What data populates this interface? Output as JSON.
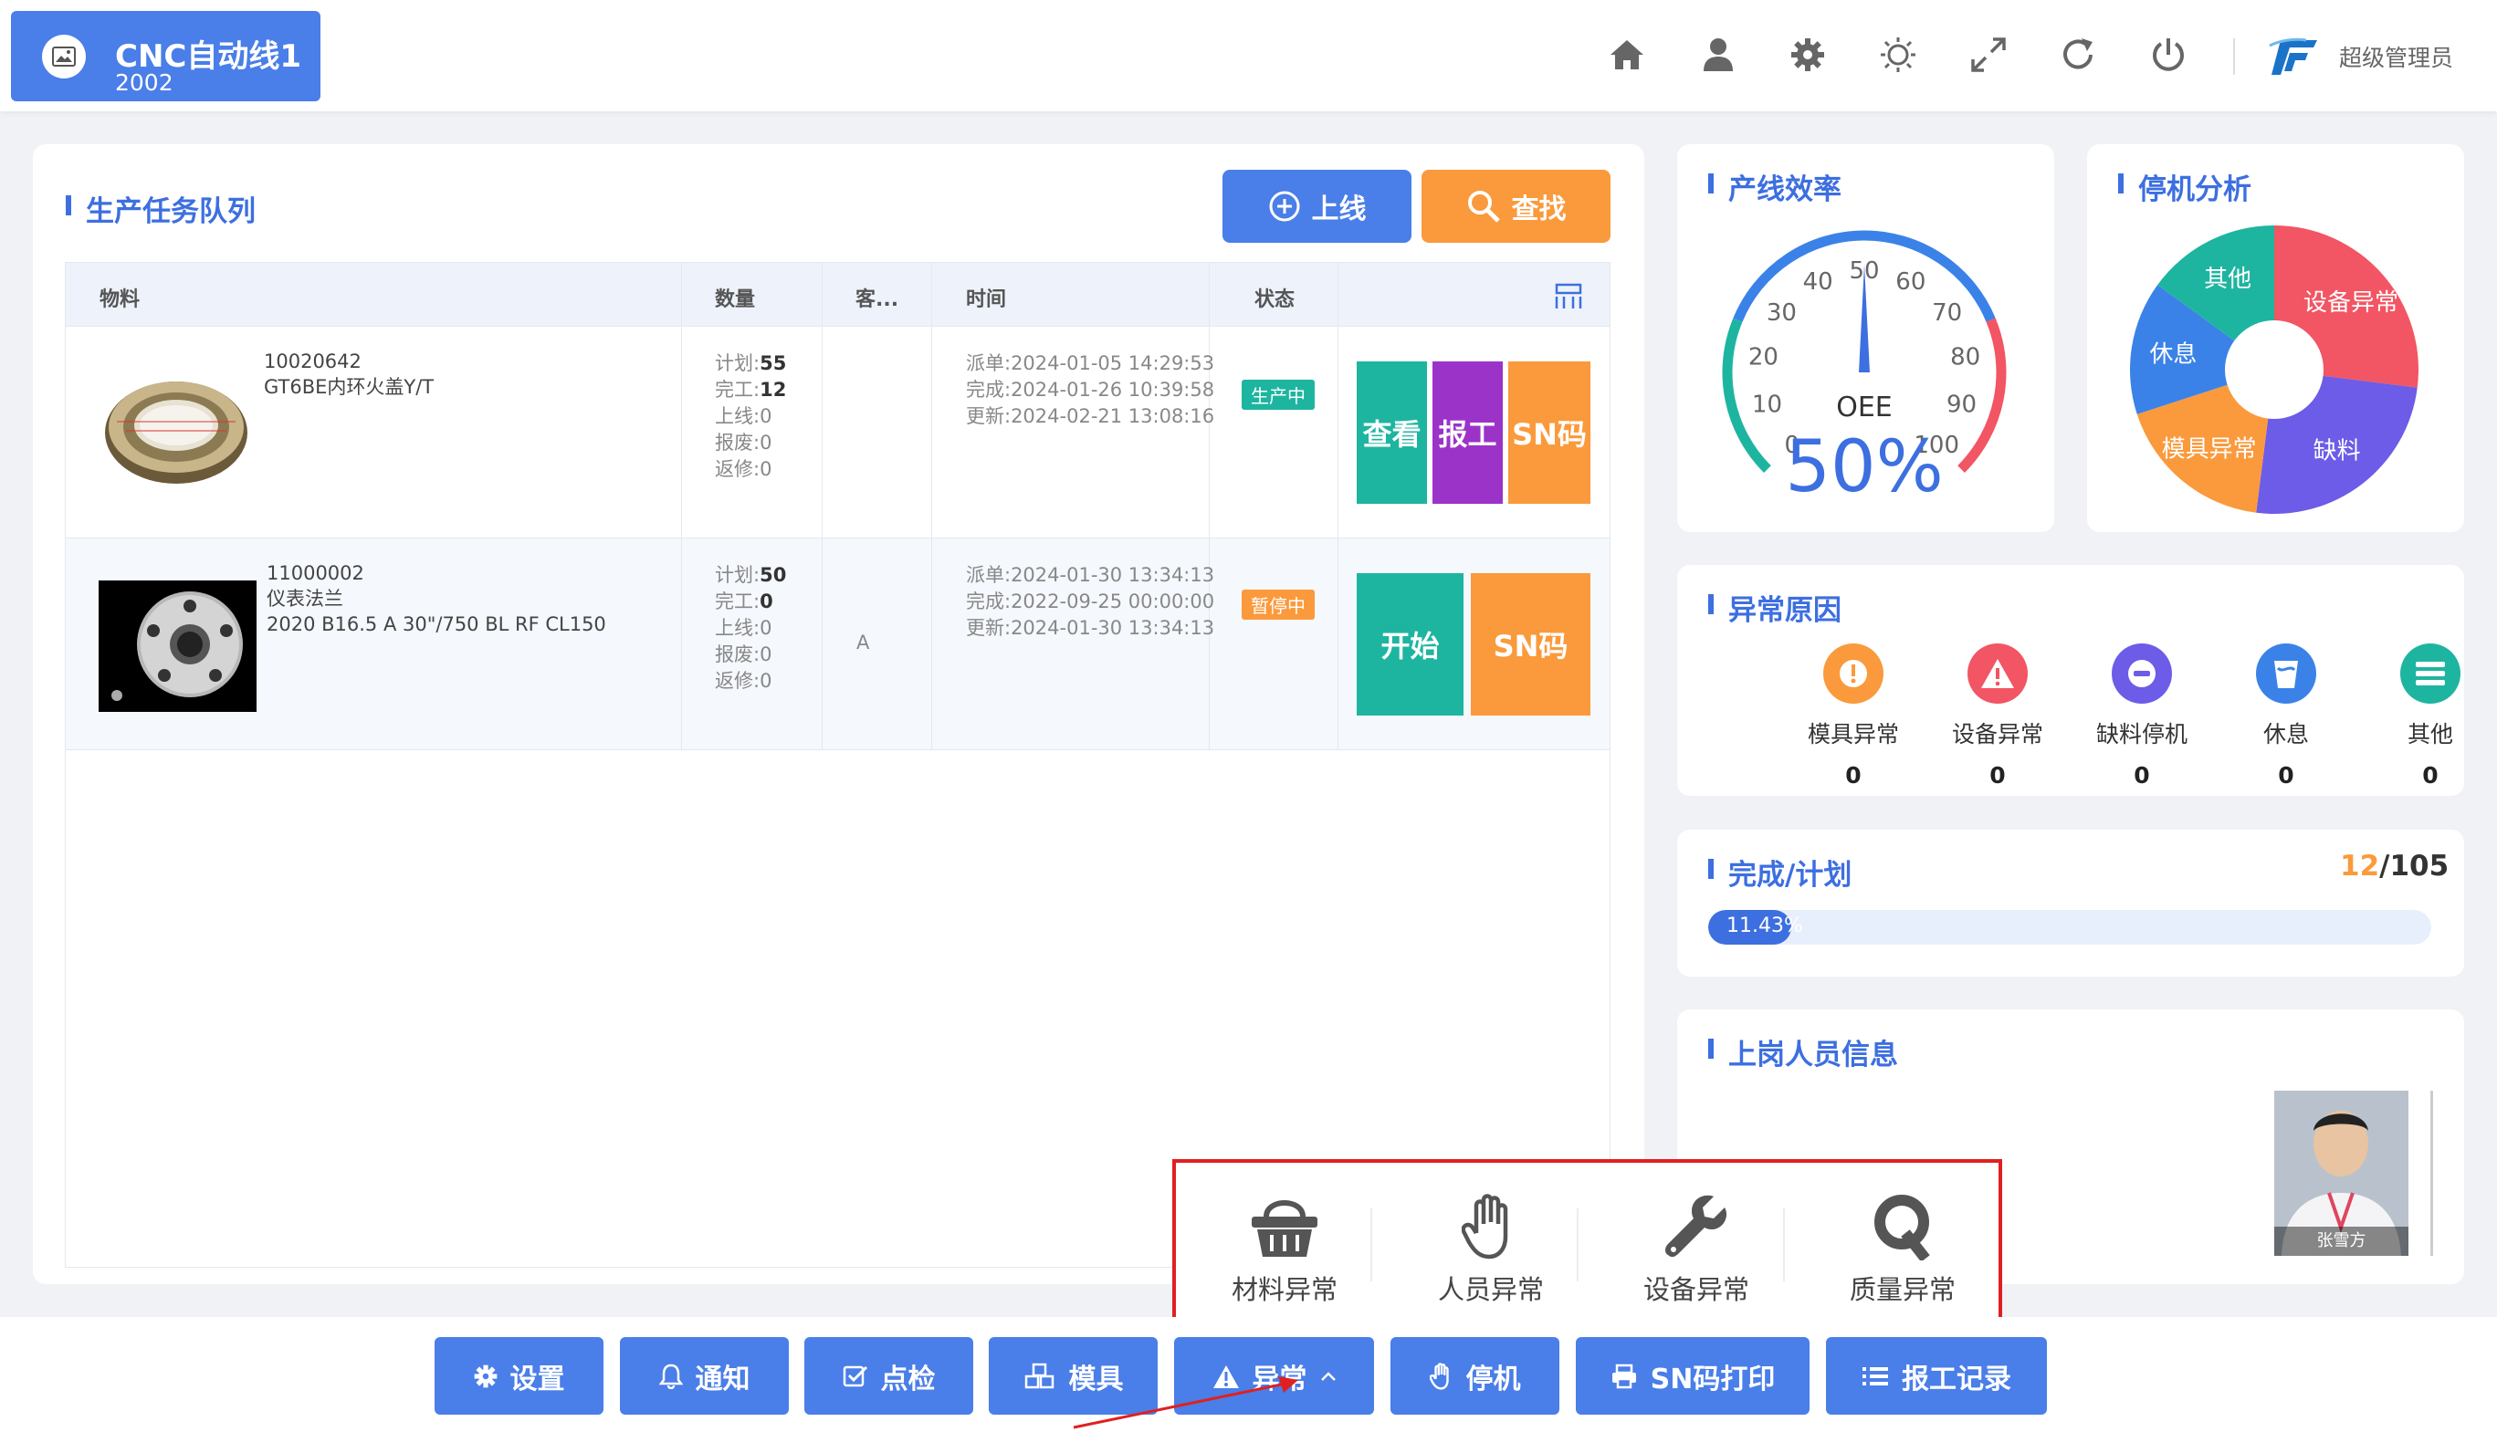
{
  "header": {
    "line_name": "CNC自动线1",
    "line_code": "2002",
    "user": "超级管理员",
    "icons": [
      "home-icon",
      "user-icon",
      "gear-icon",
      "brightness-icon",
      "fullscreen-icon",
      "refresh-icon",
      "power-icon"
    ]
  },
  "queue": {
    "title": "生产任务队列",
    "online_label": "上线",
    "search_label": "查找",
    "columns": [
      "物料",
      "数量",
      "客...",
      "时间",
      "状态"
    ],
    "rows": [
      {
        "code": "10020642",
        "name": "GT6BE内环火盖Y/T",
        "name2": "",
        "qty": [
          {
            "k": "计划:",
            "v": "55"
          },
          {
            "k": "完工:",
            "v": "12"
          },
          {
            "k": "上线:",
            "v": "0"
          },
          {
            "k": "报废:",
            "v": "0"
          },
          {
            "k": "返修:",
            "v": "0"
          }
        ],
        "customer": "",
        "times": [
          "派单:2024-01-05 14:29:53",
          "完成:2024-01-26 10:39:58",
          "更新:2024-02-21 13:08:16"
        ],
        "status": "生产中",
        "actions": [
          "查看",
          "报工",
          "SN码"
        ]
      },
      {
        "code": "11000002",
        "name": "仪表法兰",
        "name2": "2020 B16.5 A 30\"/750 BL RF CL150",
        "qty": [
          {
            "k": "计划:",
            "v": "50"
          },
          {
            "k": "完工:",
            "v": "0"
          },
          {
            "k": "上线:",
            "v": "0"
          },
          {
            "k": "报废:",
            "v": "0"
          },
          {
            "k": "返修:",
            "v": "0"
          }
        ],
        "customer": "A",
        "times": [
          "派单:2024-01-30 13:34:13",
          "完成:2022-09-25 00:00:00",
          "更新:2024-01-30 13:34:13"
        ],
        "status": "暂停中",
        "actions": [
          "开始",
          "SN码"
        ]
      }
    ]
  },
  "efficiency": {
    "title": "产线效率",
    "gauge_label": "OEE",
    "value_text": "50%",
    "value": 50,
    "ticks": [
      "0",
      "10",
      "20",
      "30",
      "40",
      "50",
      "60",
      "70",
      "80",
      "90",
      "100"
    ]
  },
  "downtime": {
    "title": "停机分析",
    "slices": [
      {
        "label": "设备异常",
        "value": 27,
        "color": "#f25563"
      },
      {
        "label": "缺料",
        "value": 25,
        "color": "#6c5ce7"
      },
      {
        "label": "模具异常",
        "value": 18,
        "color": "#fa9a3c"
      },
      {
        "label": "休息",
        "value": 15,
        "color": "#3b82e8"
      },
      {
        "label": "其他",
        "value": 15,
        "color": "#1eb5a0"
      }
    ]
  },
  "abnormal": {
    "title": "异常原因",
    "items": [
      {
        "label": "模具异常",
        "count": "0",
        "color": "#fa9a3c",
        "icon": "exclamation-icon"
      },
      {
        "label": "设备异常",
        "count": "0",
        "color": "#f25563",
        "icon": "warning-triangle-icon"
      },
      {
        "label": "缺料停机",
        "count": "0",
        "color": "#6c5ce7",
        "icon": "minus-circle-icon"
      },
      {
        "label": "休息",
        "count": "0",
        "color": "#3b82e8",
        "icon": "cup-icon"
      },
      {
        "label": "其他",
        "count": "0",
        "color": "#1eb5a0",
        "icon": "list-icon"
      }
    ]
  },
  "completion": {
    "title": "完成/计划",
    "done": "12",
    "sep": "/",
    "plan": "105",
    "percent_text": "11.43%",
    "percent": 11.43
  },
  "staff": {
    "title": "上岗人员信息",
    "name": "张雪方"
  },
  "popup": {
    "items": [
      "材料异常",
      "人员异常",
      "设备异常",
      "质量异常"
    ]
  },
  "bottom": {
    "buttons": [
      "设置",
      "通知",
      "点检",
      "模具",
      "异常",
      "停机",
      "SN码打印",
      "报工记录"
    ]
  },
  "colors": {
    "primary": "#4a7ee8",
    "orange": "#fa9a3c",
    "teal": "#1eb5a0",
    "purple": "#9c33c8",
    "title_blue": "#3d6fe0"
  }
}
